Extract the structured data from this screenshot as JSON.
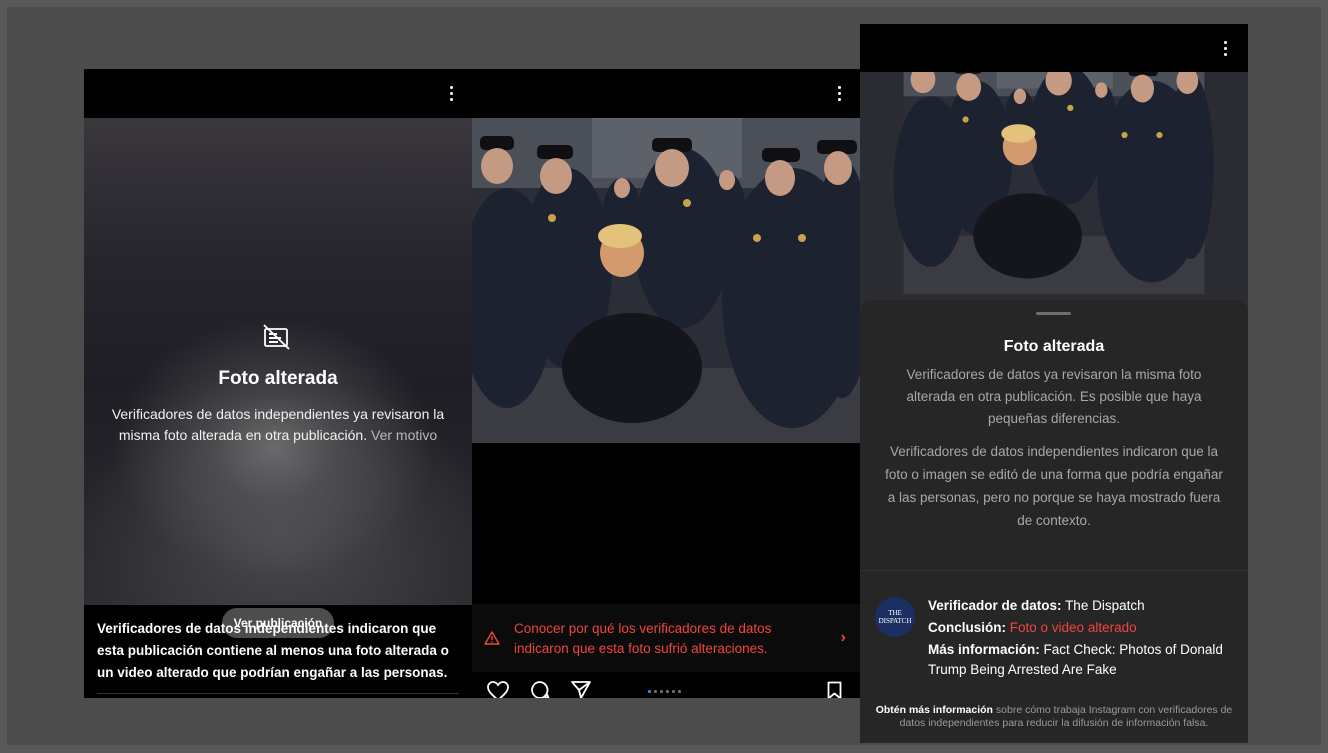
{
  "post_left": {
    "title": "Foto alterada",
    "description": "Verificadores de datos independientes ya revisaron la misma foto alterada en otra publicación.",
    "reason_link": "Ver motivo",
    "view_post_button": "Ver publicación",
    "caption": "Verificadores de datos independientes indicaron que esta publicación contiene al menos una foto alterada o un video alterado que podrían engañar a las personas.",
    "icons": [
      "more-vertical-icon",
      "altered-photo-icon"
    ]
  },
  "post_middle": {
    "warning_text": "Conocer por qué los verificadores de datos indicaron que esta foto sufrió alteraciones.",
    "warning_color": "#f0453e",
    "carousel": {
      "total": 6,
      "active": 1
    },
    "icons": [
      "more-vertical-icon",
      "warning-icon",
      "chevron-right-icon",
      "heart-icon",
      "comment-icon",
      "share-icon",
      "bookmark-icon"
    ]
  },
  "post_right": {
    "title": "Foto alterada",
    "desc1": "Verificadores de datos ya revisaron la misma foto alterada en otra publicación. Es posible que haya pequeñas diferencias.",
    "desc2": "Verificadores de datos independientes indicaron que la foto o imagen se editó de una forma que podría engañar a las personas, pero no porque se haya mostrado fuera de contexto.",
    "checker_logo_line1": "THE",
    "checker_logo_line2": "DISPATCH",
    "checker_label": "Verificador de datos:",
    "checker_value": "The Dispatch",
    "conclusion_label": "Conclusión:",
    "conclusion_value": "Foto o video alterado",
    "more_info_label": "Más información:",
    "more_info_value": "Fact Check: Photos of Donald Trump Being Arrested Are Fake",
    "footer_link": "Obtén más información",
    "footer_text": "sobre cómo trabaja Instagram con verificadores de datos independientes para reducir la difusión de información falsa."
  }
}
